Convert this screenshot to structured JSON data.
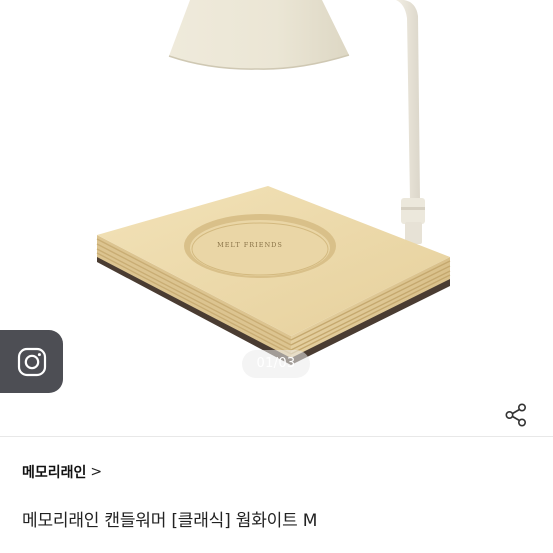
{
  "gallery": {
    "counter_text": "01/03",
    "engraving_text": "MELT FRIENDS"
  },
  "actions": {
    "instagram_icon": "instagram-icon",
    "share_icon": "share-icon"
  },
  "product": {
    "brand_name": "메모리래인",
    "brand_chevron": ">",
    "title": "메모리래인 캔들워머 [클래식] 웜화이트 M"
  },
  "colors": {
    "instagram_button_bg": "#4d4e54",
    "lamp_shade": "#ece8da",
    "wood_base": "#e9d7a8"
  }
}
